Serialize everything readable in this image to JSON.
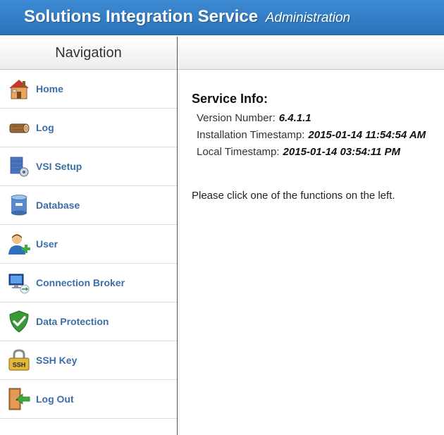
{
  "header": {
    "title": "Solutions Integration Service",
    "subtitle": "Administration"
  },
  "navigation": {
    "title": "Navigation",
    "items": [
      {
        "label": "Home",
        "icon": "home-icon"
      },
      {
        "label": "Log",
        "icon": "log-icon"
      },
      {
        "label": "VSI Setup",
        "icon": "vsi-setup-icon"
      },
      {
        "label": "Database",
        "icon": "database-icon"
      },
      {
        "label": "User",
        "icon": "user-add-icon"
      },
      {
        "label": "Connection Broker",
        "icon": "connection-broker-icon"
      },
      {
        "label": "Data Protection",
        "icon": "shield-check-icon"
      },
      {
        "label": "SSH Key",
        "icon": "ssh-lock-icon"
      },
      {
        "label": "Log Out",
        "icon": "log-out-icon"
      }
    ]
  },
  "service_info": {
    "title": "Service Info:",
    "version_label": "Version Number:",
    "version_value": "6.4.1.1",
    "install_label": "Installation Timestamp:",
    "install_value": "2015-01-14 11:54:54 AM",
    "local_label": "Local Timestamp:",
    "local_value": "2015-01-14 03:54:11 PM"
  },
  "prompt": "Please click one of the functions on the left.",
  "colors": {
    "header_bg": "#2f7cc4",
    "nav_link": "#3a6ea5"
  }
}
